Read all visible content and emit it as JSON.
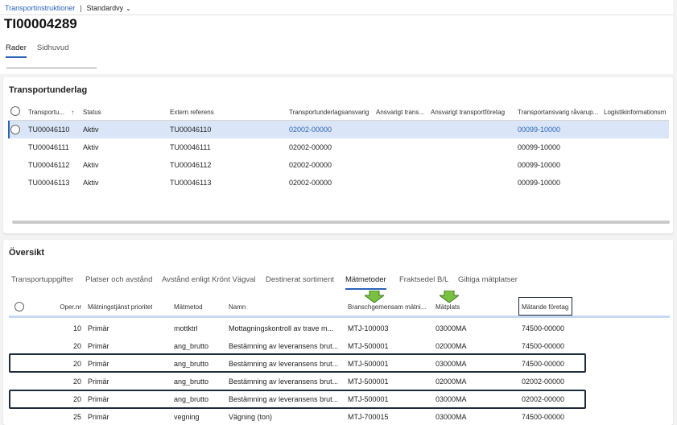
{
  "breadcrumb": {
    "link": "Transportinstruktioner",
    "separator": "|",
    "view": "Standardvy"
  },
  "page_title": "TI00004289",
  "top_tabs": [
    "Rader",
    "Sidhuvud"
  ],
  "transport_section": {
    "title": "Transportunderlag",
    "columns": [
      "Transportu...",
      "Status",
      "Extern referens",
      "Transportunderlagsansvarig",
      "Ansvarigt trans...",
      "Ansvarigt transportföretag",
      "Transportansvarig råvarup...",
      "Logistikinformationsm"
    ],
    "sort_icon": "↑",
    "rows": [
      {
        "id": "TU00046110",
        "status": "Aktiv",
        "ref": "TU00046110",
        "ansvarig": "02002-00000",
        "ansvarig_ravara": "00099-10000"
      },
      {
        "id": "TU00046111",
        "status": "Aktiv",
        "ref": "TU00046111",
        "ansvarig": "02002-00000",
        "ansvarig_ravara": "00099-10000"
      },
      {
        "id": "TU00046112",
        "status": "Aktiv",
        "ref": "TU00046112",
        "ansvarig": "02002-00000",
        "ansvarig_ravara": "00099-10000"
      },
      {
        "id": "TU00046113",
        "status": "Aktiv",
        "ref": "TU00046113",
        "ansvarig": "02002-00000",
        "ansvarig_ravara": "00099-10000"
      }
    ]
  },
  "overview_section": {
    "title": "Översikt",
    "tabs": [
      "Transportuppgifter",
      "Platser och avstånd",
      "Avstånd enligt Krönt Vägval",
      "Destinerat sortiment",
      "Mätmetoder",
      "Fraktsedel B/L",
      "Giltiga mätplatser"
    ],
    "active_tab": "Mätmetoder",
    "columns": [
      "Oper.nr",
      "Mätningstjänst prioritet",
      "Mätmetod",
      "Namn",
      "Branschgemensam mätni...",
      "Mätplats",
      "Mätande företag"
    ],
    "rows": [
      {
        "oper": "10",
        "prio": "Primär",
        "metod": "mottktrl",
        "namn": "Mottagningskontroll av trave m...",
        "bransch": "MTJ-100003",
        "plats": "03000MA",
        "foretag": "74500-00000"
      },
      {
        "oper": "20",
        "prio": "Primär",
        "metod": "ang_brutto",
        "namn": "Bestämning av leveransens brut...",
        "bransch": "MTJ-500001",
        "plats": "02000MA",
        "foretag": "74500-00000"
      },
      {
        "oper": "20",
        "prio": "Primär",
        "metod": "ang_brutto",
        "namn": "Bestämning av leveransens brut...",
        "bransch": "MTJ-500001",
        "plats": "03000MA",
        "foretag": "74500-00000"
      },
      {
        "oper": "20",
        "prio": "Primär",
        "metod": "ang_brutto",
        "namn": "Bestämning av leveransens brut...",
        "bransch": "MTJ-500001",
        "plats": "02000MA",
        "foretag": "02002-00000"
      },
      {
        "oper": "20",
        "prio": "Primär",
        "metod": "ang_brutto",
        "namn": "Bestämning av leveransens brut...",
        "bransch": "MTJ-500001",
        "plats": "03000MA",
        "foretag": "02002-00000"
      },
      {
        "oper": "25",
        "prio": "Primär",
        "metod": "vegning",
        "namn": "Vägning (ton)",
        "bransch": "MTJ-700015",
        "plats": "03000MA",
        "foretag": "74500-00000"
      }
    ]
  },
  "colors": {
    "accent": "#2a63b8",
    "selected_row": "#dae6f7",
    "highlight_box": "#1e2b3c",
    "annotation_arrow": "#7ac142"
  }
}
